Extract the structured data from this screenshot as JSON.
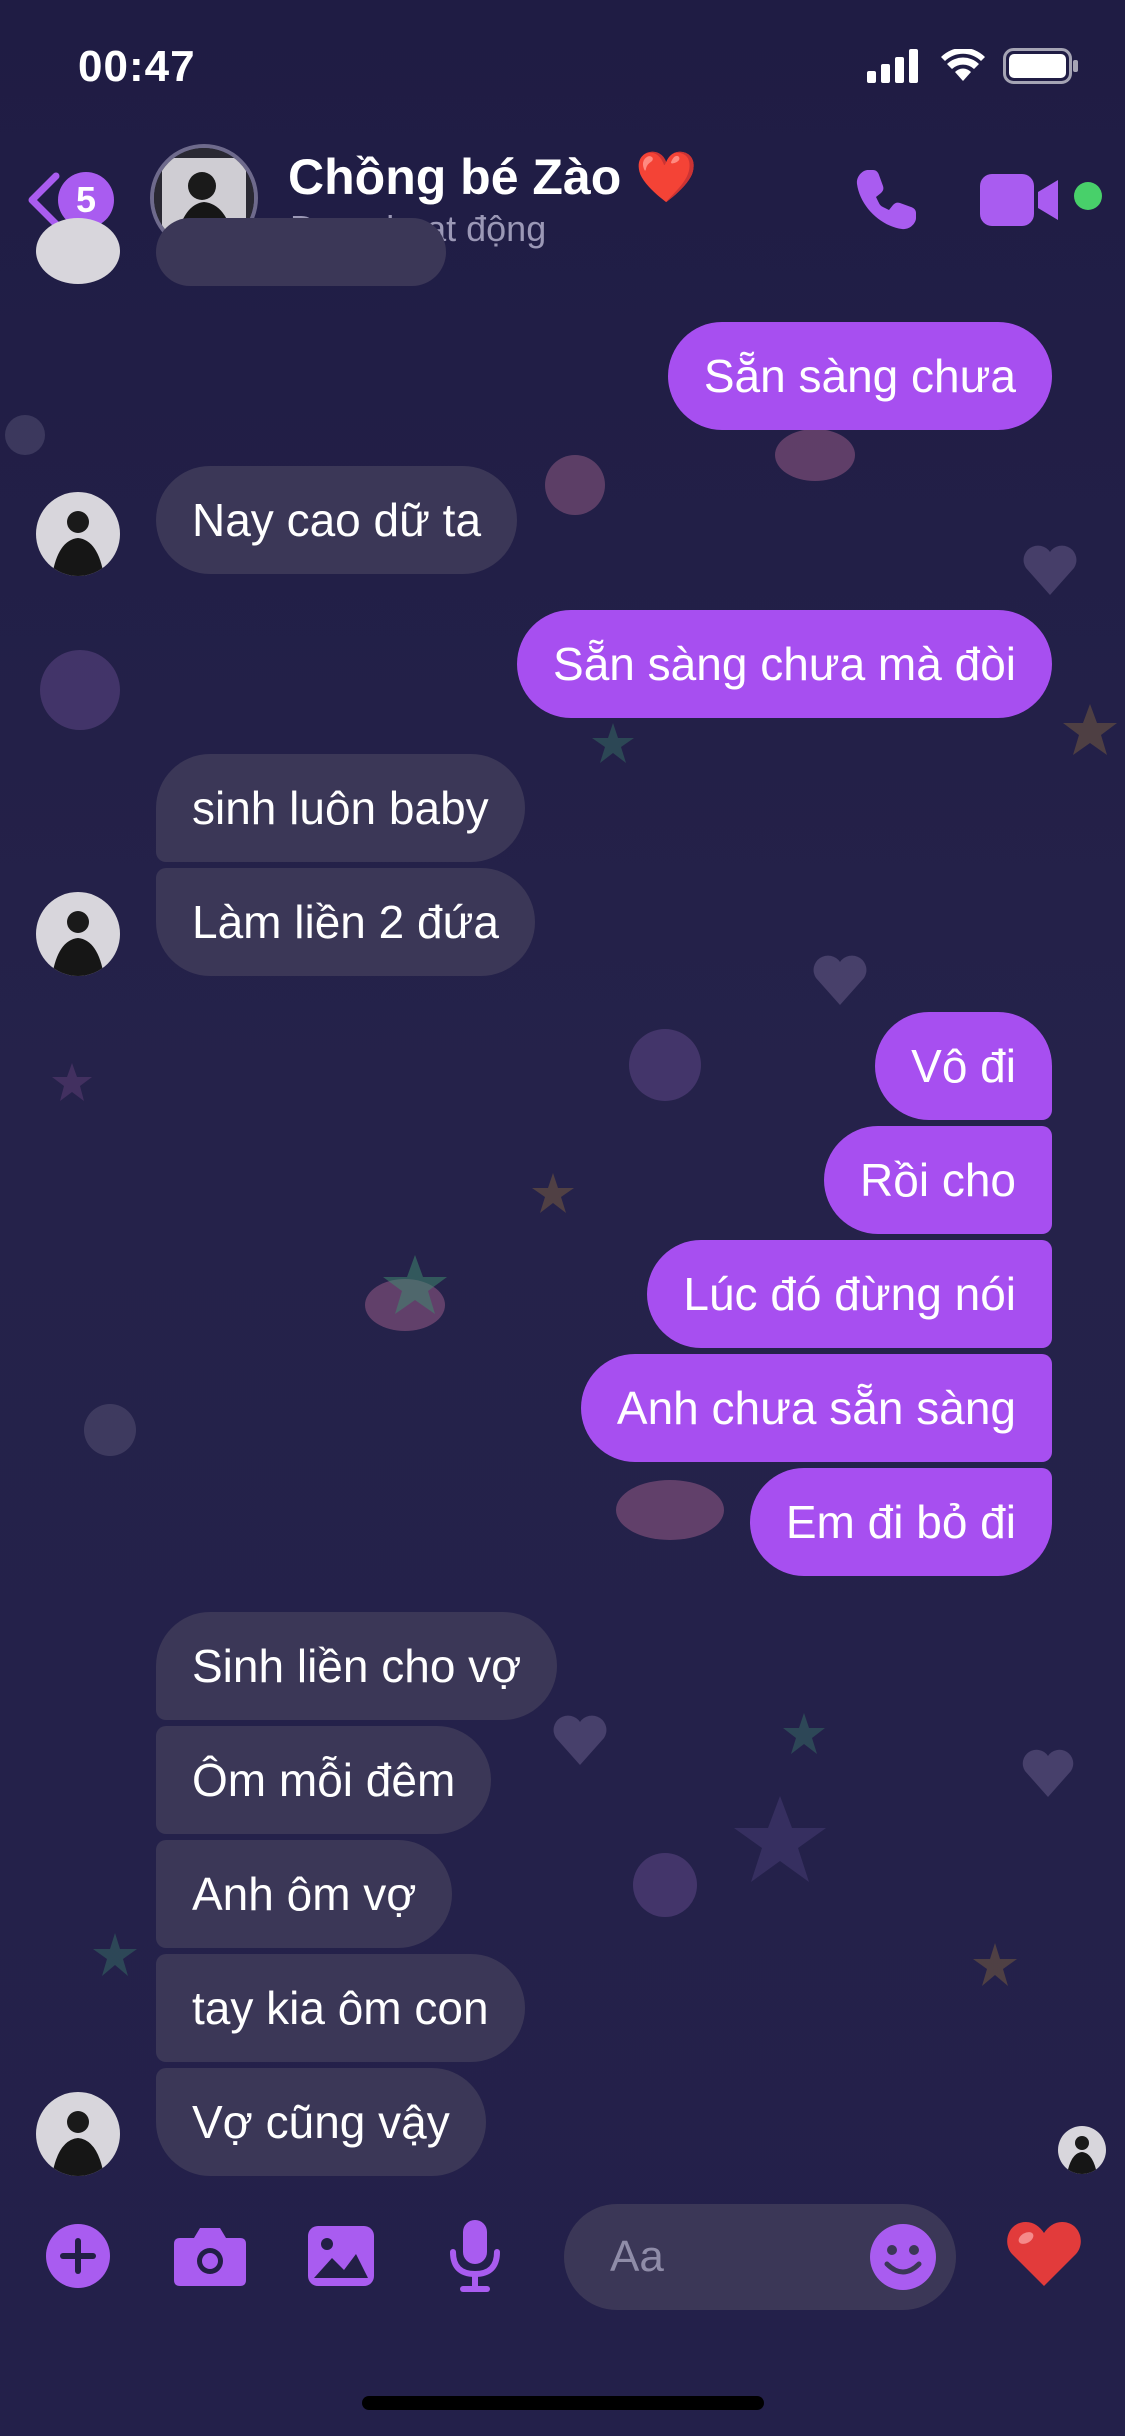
{
  "status_bar": {
    "time": "00:47"
  },
  "header": {
    "back_badge": "5",
    "contact_name": "Chồng bé Zào ❤️",
    "contact_status": "Đang hoạt động"
  },
  "messages": [
    {
      "text": "Sẵn sàng chưa",
      "dir": "out"
    },
    {
      "text": "Nay cao dữ ta",
      "dir": "in"
    },
    {
      "text": "Sẵn sàng chưa mà đòi",
      "dir": "out"
    },
    {
      "text": "sinh luôn baby",
      "dir": "in"
    },
    {
      "text": "Làm liền 2 đứa",
      "dir": "in"
    },
    {
      "text": "Vô đi",
      "dir": "out"
    },
    {
      "text": "Rồi cho",
      "dir": "out"
    },
    {
      "text": "Lúc đó đừng nói",
      "dir": "out"
    },
    {
      "text": "Anh chưa sẵn sàng",
      "dir": "out"
    },
    {
      "text": "Em đi bỏ đi",
      "dir": "out"
    },
    {
      "text": "Sinh liền cho vợ",
      "dir": "in"
    },
    {
      "text": "Ôm mỗi đêm",
      "dir": "in"
    },
    {
      "text": "Anh ôm vợ",
      "dir": "in"
    },
    {
      "text": "tay kia ôm con",
      "dir": "in"
    },
    {
      "text": "Vợ cũng vậy",
      "dir": "in"
    }
  ],
  "composer": {
    "placeholder": "Aa"
  },
  "icons": [
    "back-icon",
    "phone-icon",
    "video-icon",
    "plus-icon",
    "camera-icon",
    "image-icon",
    "mic-icon",
    "emoji-icon",
    "heart-icon"
  ],
  "colors": {
    "background": "#221f45",
    "outgoing_bubble": "#a74ff0",
    "incoming_bubble": "#3b3757",
    "accent": "#a95cf0",
    "online": "#48d06a"
  }
}
